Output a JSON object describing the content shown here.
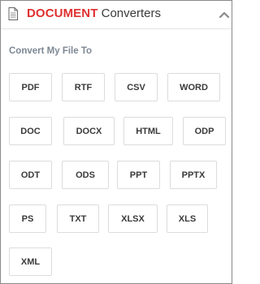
{
  "header": {
    "brand": "DOCUMENT",
    "title_rest": " Converters",
    "icons": {
      "document": "document-icon",
      "collapse": "chevron-up-icon"
    },
    "colors": {
      "brand": "#e03030",
      "section_title": "#7d8894",
      "button_border": "#dcdcdc"
    }
  },
  "section": {
    "title": "Convert My File To"
  },
  "formats": [
    {
      "label": "PDF"
    },
    {
      "label": "RTF"
    },
    {
      "label": "CSV"
    },
    {
      "label": "WORD"
    },
    {
      "label": "DOC"
    },
    {
      "label": "DOCX"
    },
    {
      "label": "HTML"
    },
    {
      "label": "ODP"
    },
    {
      "label": "ODT"
    },
    {
      "label": "ODS"
    },
    {
      "label": "PPT"
    },
    {
      "label": "PPTX"
    },
    {
      "label": "PS"
    },
    {
      "label": "TXT"
    },
    {
      "label": "XLSX"
    },
    {
      "label": "XLS"
    },
    {
      "label": "XML"
    }
  ]
}
